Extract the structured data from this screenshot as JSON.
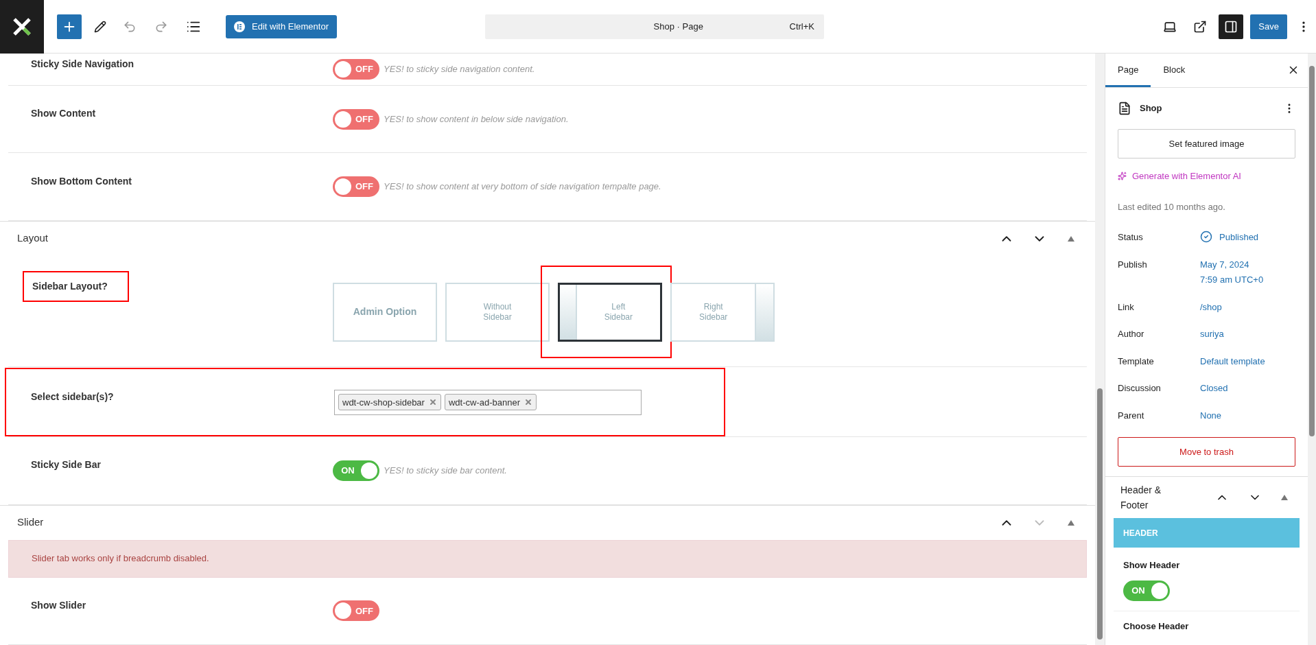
{
  "toolbar": {
    "elementor_button": "Edit with Elementor",
    "command": {
      "title": "Shop · Page",
      "shortcut": "Ctrl+K"
    },
    "save_button": "Save"
  },
  "main": [
    {
      "kind": "toggle",
      "label": "Sticky Side Navigation",
      "on": false,
      "state_text": "OFF",
      "hint": "YES! to sticky side navigation content."
    },
    {
      "kind": "toggle",
      "label": "Show Content",
      "on": false,
      "state_text": "OFF",
      "hint": "YES! to show content in below side navigation."
    },
    {
      "kind": "toggle",
      "label": "Show Bottom Content",
      "on": false,
      "state_text": "OFF",
      "hint": "YES! to show content at very bottom of side navigation tempalte page."
    },
    {
      "kind": "section",
      "title": "Layout",
      "down_disabled": false
    },
    {
      "kind": "layout",
      "label": "Sidebar Layout?",
      "highlighted": true,
      "options": [
        {
          "text": "Admin Option",
          "kind": "admin",
          "selected": false,
          "highlighted": false
        },
        {
          "text": "Without Sidebar",
          "kind": "none",
          "selected": false,
          "highlighted": false
        },
        {
          "text": "Left Sidebar",
          "kind": "left",
          "selected": true,
          "highlighted": true
        },
        {
          "text": "Right Sidebar",
          "kind": "right",
          "selected": false,
          "highlighted": false
        }
      ]
    },
    {
      "kind": "tags",
      "label": "Select sidebar(s)?",
      "highlighted": true,
      "tags": [
        "wdt-cw-shop-sidebar",
        "wdt-cw-ad-banner"
      ]
    },
    {
      "kind": "toggle",
      "label": "Sticky Side Bar",
      "on": true,
      "state_text": "ON",
      "hint": "YES! to sticky side bar content."
    },
    {
      "kind": "section",
      "title": "Slider",
      "down_disabled": true
    },
    {
      "kind": "alert",
      "text": "Slider tab works only if breadcrumb disabled."
    },
    {
      "kind": "toggle",
      "label": "Show Slider",
      "on": false,
      "state_text": "OFF"
    }
  ],
  "panel": {
    "tabs": [
      {
        "label": "Page",
        "selected": true
      },
      {
        "label": "Block",
        "selected": false
      }
    ],
    "title": "Shop",
    "featured_button": "Set featured image",
    "ai_link": "Generate with Elementor AI",
    "last_edited": "Last edited 10 months ago.",
    "fields": [
      {
        "label": "Status",
        "kind": "status",
        "lines": [
          "Published"
        ]
      },
      {
        "label": "Publish",
        "kind": "link",
        "lines": [
          "May 7, 2024",
          "7:59 am UTC+0"
        ]
      },
      {
        "label": "Link",
        "kind": "link",
        "lines": [
          "/shop"
        ]
      },
      {
        "label": "Author",
        "kind": "link",
        "lines": [
          "suriya"
        ]
      },
      {
        "label": "Template",
        "kind": "link",
        "lines": [
          "Default template"
        ]
      },
      {
        "label": "Discussion",
        "kind": "link",
        "lines": [
          "Closed"
        ]
      },
      {
        "label": "Parent",
        "kind": "link",
        "lines": [
          "None"
        ]
      }
    ],
    "trash_button": "Move to trash",
    "meta_box": {
      "title": "Header & Footer",
      "tab": "HEADER",
      "show_header": {
        "label": "Show Header",
        "on": true,
        "state_text": "ON"
      },
      "choose_header": "Choose Header"
    }
  }
}
